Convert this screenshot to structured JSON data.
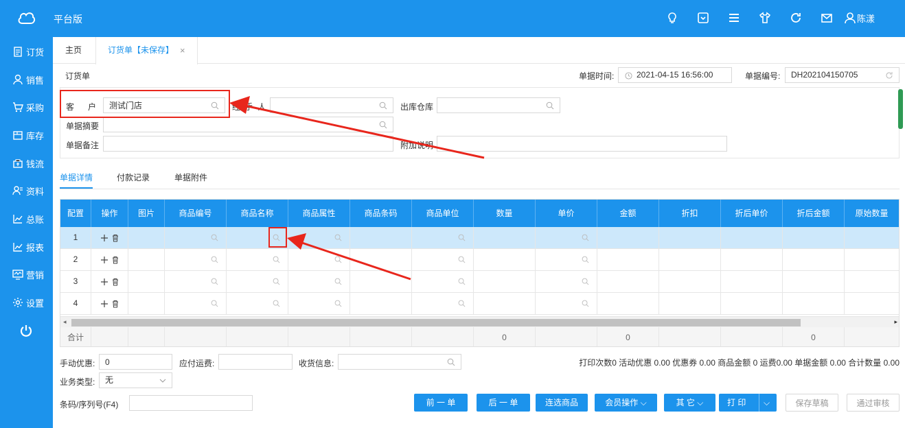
{
  "app": {
    "brand": "平台版",
    "user": "陈漾"
  },
  "sidebar": {
    "items": [
      {
        "label": "订货",
        "icon": "order-icon"
      },
      {
        "label": "销售",
        "icon": "sales-icon"
      },
      {
        "label": "采购",
        "icon": "cart-icon"
      },
      {
        "label": "库存",
        "icon": "inventory-icon"
      },
      {
        "label": "钱流",
        "icon": "money-icon"
      },
      {
        "label": "资料",
        "icon": "profile-icon"
      },
      {
        "label": "总账",
        "icon": "ledger-icon"
      },
      {
        "label": "报表",
        "icon": "report-icon"
      },
      {
        "label": "营销",
        "icon": "marketing-icon"
      },
      {
        "label": "设置",
        "icon": "gear-icon"
      }
    ]
  },
  "tabs": {
    "home": "主页",
    "active": "订货单【未保存】",
    "close": "×"
  },
  "form": {
    "title": "订货单",
    "time_label": "单据时间:",
    "time_value": "2021-04-15 16:56:00",
    "no_label": "单据编号:",
    "no_value": "DH202104150705",
    "customer_label": "客      户",
    "customer_value": "测试门店",
    "handler_label": "经  手  人",
    "handler_value": "",
    "warehouse_label": "出库仓库",
    "warehouse_value": "",
    "summary_label": "单据摘要",
    "summary_value": "",
    "remark_label": "单据备注",
    "remark_value": "",
    "extra_label": "附加说明",
    "extra_value": ""
  },
  "subtabs": [
    "单据详情",
    "付款记录",
    "单据附件"
  ],
  "grid": {
    "headers": [
      "配置",
      "操作",
      "图片",
      "商品编号",
      "商品名称",
      "商品属性",
      "商品条码",
      "商品单位",
      "数量",
      "单价",
      "金额",
      "折扣",
      "折后单价",
      "折后金额",
      "原始数量"
    ],
    "rows": [
      "1",
      "2",
      "3",
      "4"
    ],
    "totals_label": "合计",
    "total_qty": "0",
    "total_amount": "0",
    "total_disc_amount": "0"
  },
  "bottom": {
    "manual_disc_label": "手动优惠:",
    "manual_disc_value": "0",
    "freight_label": "应付运费:",
    "freight_value": "",
    "receive_label": "收货信息:",
    "receive_value": "",
    "biz_type_label": "业务类型:",
    "biz_type_value": "无",
    "barcode_label": "条码/序列号(F4)",
    "barcode_value": "",
    "stats": "打印次数0  活动优惠 0.00  优惠券 0.00  商品金额 0  运费0.00  单据金额 0.00  合计数量 0.00"
  },
  "buttons": {
    "prev": "前 一 单",
    "next": "后 一 单",
    "select": "连选商品",
    "member": "会员操作",
    "other": "其 它",
    "print": "打 印",
    "save_draft": "保存草稿",
    "approve": "通过审核"
  }
}
